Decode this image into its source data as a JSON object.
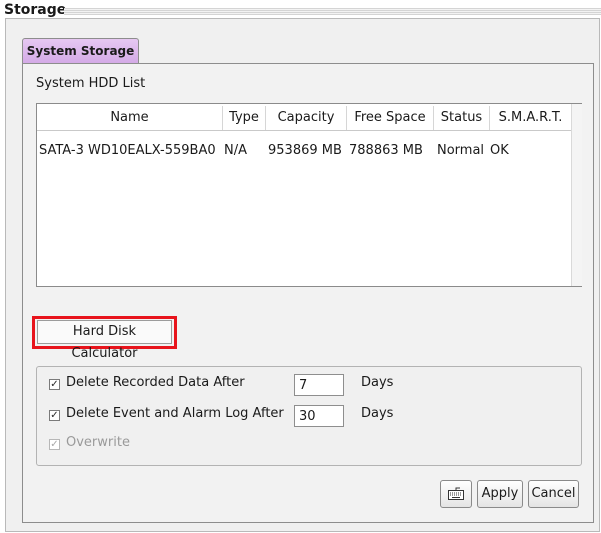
{
  "window": {
    "title": "Storage"
  },
  "tabs": [
    {
      "label": "System Storage",
      "active": true
    }
  ],
  "hdd_list": {
    "label": "System HDD List",
    "columns": [
      "Name",
      "Type",
      "Capacity",
      "Free Space",
      "Status",
      "S.M.A.R.T."
    ],
    "rows": [
      {
        "name": "SATA-3 WD10EALX-559BA0",
        "type": "N/A",
        "capacity": "953869 MB",
        "free_space": "788863 MB",
        "status": "Normal",
        "smart": "OK"
      }
    ]
  },
  "calculator_button": {
    "label": "Hard Disk Calculator",
    "highlight_color": "#e8141c"
  },
  "options": {
    "delete_recorded": {
      "label": "Delete Recorded Data After",
      "checked": true,
      "value": "7",
      "unit": "Days"
    },
    "delete_event_log": {
      "label": "Delete Event and Alarm Log After",
      "checked": true,
      "value": "30",
      "unit": "Days"
    },
    "overwrite": {
      "label": "Overwrite",
      "checked": true,
      "disabled": true
    }
  },
  "actions": {
    "keyboard_icon": "keyboard-icon",
    "apply_label": "Apply",
    "cancel_label": "Cancel"
  },
  "colors": {
    "tab_accent": "#dcb6ee",
    "highlight": "#e8141c"
  }
}
